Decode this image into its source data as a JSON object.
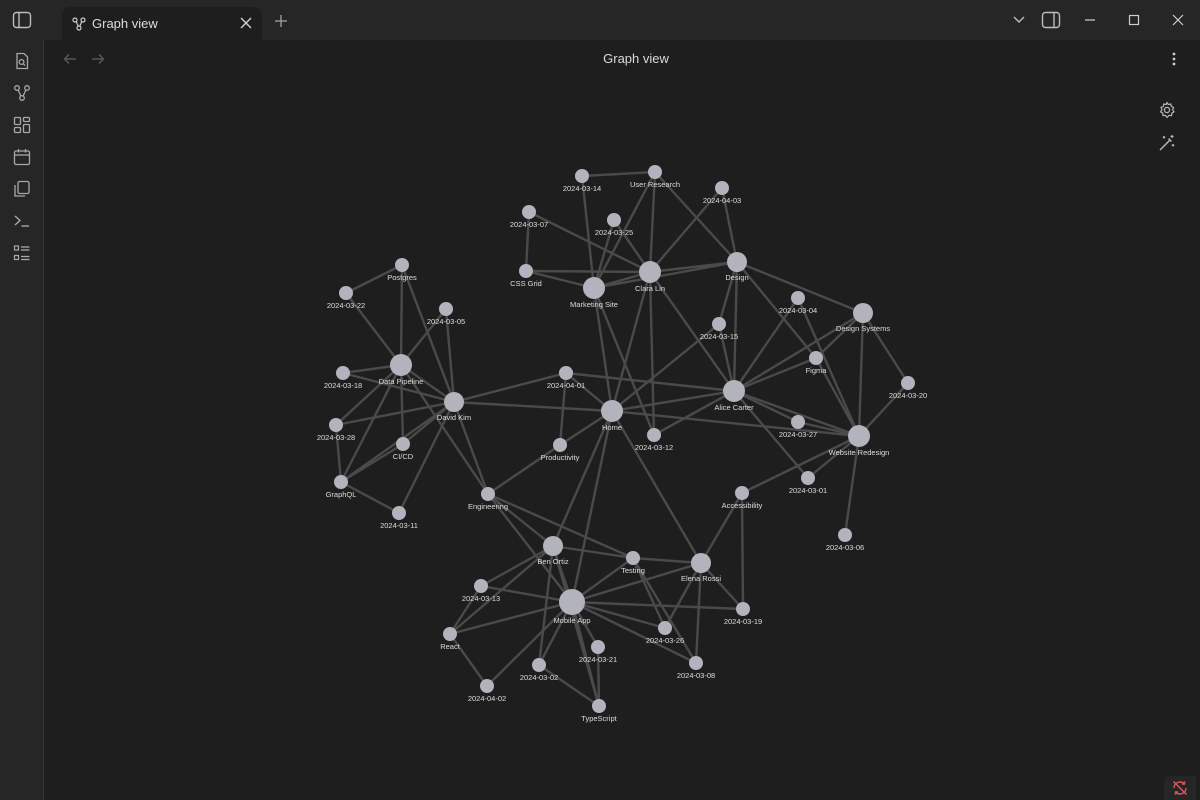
{
  "tab": {
    "label": "Graph view",
    "icon": "graph-icon"
  },
  "view": {
    "title": "Graph view"
  },
  "ribbon": {
    "items": [
      "quick-switcher-icon",
      "graph-icon",
      "canvas-icon",
      "daily-note-icon",
      "templates-icon",
      "command-palette-icon",
      "bases-icon"
    ]
  },
  "colors": {
    "node": "#b3b3bd",
    "edge": "#4a4a4a",
    "label": "#dcddde",
    "background": "#1e1e1e"
  },
  "graph": {
    "nodes": [
      {
        "id": "home",
        "label": "Home",
        "size": "large"
      },
      {
        "id": "alice",
        "label": "Alice Carter",
        "size": "large"
      },
      {
        "id": "clara",
        "label": "Clara Lin",
        "size": "large"
      },
      {
        "id": "mktsite",
        "label": "Marketing Site",
        "size": "large"
      },
      {
        "id": "datapipe",
        "label": "Data Pipeline",
        "size": "large"
      },
      {
        "id": "david",
        "label": "David Kim",
        "size": "medium"
      },
      {
        "id": "mobile",
        "label": "Mobile App",
        "size": "xlarge"
      },
      {
        "id": "ben",
        "label": "Ben Ortiz",
        "size": "medium"
      },
      {
        "id": "elena",
        "label": "Elena Rossi",
        "size": "medium"
      },
      {
        "id": "webredesign",
        "label": "Website Redesign",
        "size": "large"
      },
      {
        "id": "design",
        "label": "Design",
        "size": "medium"
      },
      {
        "id": "designsys",
        "label": "Design Systems",
        "size": "medium"
      },
      {
        "id": "figma",
        "label": "Figma",
        "size": "small"
      },
      {
        "id": "userresearch",
        "label": "User Research",
        "size": "small"
      },
      {
        "id": "d0314",
        "label": "2024-03-14",
        "size": "small"
      },
      {
        "id": "d0403",
        "label": "2024-04-03",
        "size": "small"
      },
      {
        "id": "d0307",
        "label": "2024-03-07",
        "size": "small"
      },
      {
        "id": "d0325",
        "label": "2024-03-25",
        "size": "small"
      },
      {
        "id": "cssgrid",
        "label": "CSS Grid",
        "size": "small"
      },
      {
        "id": "postgres",
        "label": "Postgres",
        "size": "small"
      },
      {
        "id": "d0322",
        "label": "2024-03-22",
        "size": "small"
      },
      {
        "id": "d0305",
        "label": "2024-03-05",
        "size": "small"
      },
      {
        "id": "d0318",
        "label": "2024-03-18",
        "size": "small"
      },
      {
        "id": "d0401",
        "label": "2024-04-01",
        "size": "small"
      },
      {
        "id": "d0328",
        "label": "2024-03-28",
        "size": "small"
      },
      {
        "id": "cicd",
        "label": "CI/CD",
        "size": "small"
      },
      {
        "id": "productivity",
        "label": "Productivity",
        "size": "small"
      },
      {
        "id": "d0312",
        "label": "2024-03-12",
        "size": "small"
      },
      {
        "id": "graphql",
        "label": "GraphQL",
        "size": "small"
      },
      {
        "id": "d0311",
        "label": "2024-03-11",
        "size": "small"
      },
      {
        "id": "engineering",
        "label": "Engineering",
        "size": "small"
      },
      {
        "id": "d0304",
        "label": "2024-03-04",
        "size": "small"
      },
      {
        "id": "d0315",
        "label": "2024-03-15",
        "size": "small"
      },
      {
        "id": "d0320",
        "label": "2024-03-20",
        "size": "small"
      },
      {
        "id": "d0327",
        "label": "2024-03-27",
        "size": "small"
      },
      {
        "id": "d0301",
        "label": "2024-03-01",
        "size": "small"
      },
      {
        "id": "accessibility",
        "label": "Accessibility",
        "size": "small"
      },
      {
        "id": "d0306",
        "label": "2024-03-06",
        "size": "small"
      },
      {
        "id": "testing",
        "label": "Testing",
        "size": "small"
      },
      {
        "id": "d0313",
        "label": "2024-03-13",
        "size": "small"
      },
      {
        "id": "d0319",
        "label": "2024-03-19",
        "size": "small"
      },
      {
        "id": "react",
        "label": "React",
        "size": "small"
      },
      {
        "id": "d0326",
        "label": "2024-03-26",
        "size": "small"
      },
      {
        "id": "d0321",
        "label": "2024-03-21",
        "size": "small"
      },
      {
        "id": "d0302",
        "label": "2024-03-02",
        "size": "small"
      },
      {
        "id": "d0308",
        "label": "2024-03-08",
        "size": "small"
      },
      {
        "id": "d0402",
        "label": "2024-04-02",
        "size": "small"
      },
      {
        "id": "typescript",
        "label": "TypeScript",
        "size": "small"
      }
    ],
    "edges": [
      [
        "d0314",
        "userresearch"
      ],
      [
        "d0314",
        "mktsite"
      ],
      [
        "userresearch",
        "clara"
      ],
      [
        "userresearch",
        "mktsite"
      ],
      [
        "userresearch",
        "design"
      ],
      [
        "d0403",
        "design"
      ],
      [
        "d0403",
        "clara"
      ],
      [
        "d0307",
        "cssgrid"
      ],
      [
        "d0307",
        "clara"
      ],
      [
        "d0325",
        "mktsite"
      ],
      [
        "d0325",
        "clara"
      ],
      [
        "cssgrid",
        "mktsite"
      ],
      [
        "cssgrid",
        "clara"
      ],
      [
        "mktsite",
        "clara"
      ],
      [
        "mktsite",
        "design"
      ],
      [
        "clara",
        "design"
      ],
      [
        "mktsite",
        "home"
      ],
      [
        "mktsite",
        "d0312"
      ],
      [
        "clara",
        "home"
      ],
      [
        "clara",
        "alice"
      ],
      [
        "clara",
        "d0312"
      ],
      [
        "design",
        "designsys"
      ],
      [
        "design",
        "alice"
      ],
      [
        "design",
        "figma"
      ],
      [
        "design",
        "d0315"
      ],
      [
        "d0304",
        "alice"
      ],
      [
        "d0304",
        "webredesign"
      ],
      [
        "designsys",
        "alice"
      ],
      [
        "designsys",
        "webredesign"
      ],
      [
        "designsys",
        "d0320"
      ],
      [
        "designsys",
        "figma"
      ],
      [
        "figma",
        "alice"
      ],
      [
        "figma",
        "webredesign"
      ],
      [
        "d0315",
        "alice"
      ],
      [
        "d0315",
        "home"
      ],
      [
        "d0320",
        "webredesign"
      ],
      [
        "alice",
        "home"
      ],
      [
        "alice",
        "d0327"
      ],
      [
        "alice",
        "webredesign"
      ],
      [
        "alice",
        "d0301"
      ],
      [
        "alice",
        "d0401"
      ],
      [
        "alice",
        "d0312"
      ],
      [
        "d0327",
        "webredesign"
      ],
      [
        "home",
        "webredesign"
      ],
      [
        "home",
        "d0401"
      ],
      [
        "home",
        "productivity"
      ],
      [
        "home",
        "david"
      ],
      [
        "home",
        "ben"
      ],
      [
        "home",
        "elena"
      ],
      [
        "home",
        "mobile"
      ],
      [
        "d0401",
        "david"
      ],
      [
        "d0401",
        "productivity"
      ],
      [
        "productivity",
        "engineering"
      ],
      [
        "d0312",
        "alice"
      ],
      [
        "webredesign",
        "accessibility"
      ],
      [
        "webredesign",
        "d0306"
      ],
      [
        "accessibility",
        "elena"
      ],
      [
        "accessibility",
        "d0319"
      ],
      [
        "d0301",
        "webredesign"
      ],
      [
        "postgres",
        "d0322"
      ],
      [
        "postgres",
        "datapipe"
      ],
      [
        "postgres",
        "david"
      ],
      [
        "d0322",
        "datapipe"
      ],
      [
        "d0305",
        "datapipe"
      ],
      [
        "d0305",
        "david"
      ],
      [
        "d0318",
        "datapipe"
      ],
      [
        "d0318",
        "david"
      ],
      [
        "datapipe",
        "david"
      ],
      [
        "datapipe",
        "d0328"
      ],
      [
        "datapipe",
        "cicd"
      ],
      [
        "datapipe",
        "graphql"
      ],
      [
        "datapipe",
        "engineering"
      ],
      [
        "david",
        "cicd"
      ],
      [
        "david",
        "d0328"
      ],
      [
        "david",
        "graphql"
      ],
      [
        "david",
        "engineering"
      ],
      [
        "david",
        "d0311"
      ],
      [
        "d0328",
        "graphql"
      ],
      [
        "cicd",
        "graphql"
      ],
      [
        "graphql",
        "d0311"
      ],
      [
        "engineering",
        "ben"
      ],
      [
        "engineering",
        "testing"
      ],
      [
        "engineering",
        "mobile"
      ],
      [
        "ben",
        "d0313"
      ],
      [
        "ben",
        "react"
      ],
      [
        "ben",
        "mobile"
      ],
      [
        "ben",
        "testing"
      ],
      [
        "ben",
        "d0302"
      ],
      [
        "ben",
        "typescript"
      ],
      [
        "testing",
        "elena"
      ],
      [
        "testing",
        "mobile"
      ],
      [
        "testing",
        "d0326"
      ],
      [
        "testing",
        "d0308"
      ],
      [
        "elena",
        "mobile"
      ],
      [
        "elena",
        "d0326"
      ],
      [
        "elena",
        "d0319"
      ],
      [
        "elena",
        "d0308"
      ],
      [
        "mobile",
        "d0313"
      ],
      [
        "mobile",
        "react"
      ],
      [
        "mobile",
        "d0326"
      ],
      [
        "mobile",
        "d0321"
      ],
      [
        "mobile",
        "d0302"
      ],
      [
        "mobile",
        "typescript"
      ],
      [
        "mobile",
        "d0402"
      ],
      [
        "mobile",
        "d0308"
      ],
      [
        "mobile",
        "d0319"
      ],
      [
        "react",
        "d0313"
      ],
      [
        "react",
        "d0402"
      ],
      [
        "d0321",
        "typescript"
      ],
      [
        "d0302",
        "typescript"
      ]
    ]
  }
}
